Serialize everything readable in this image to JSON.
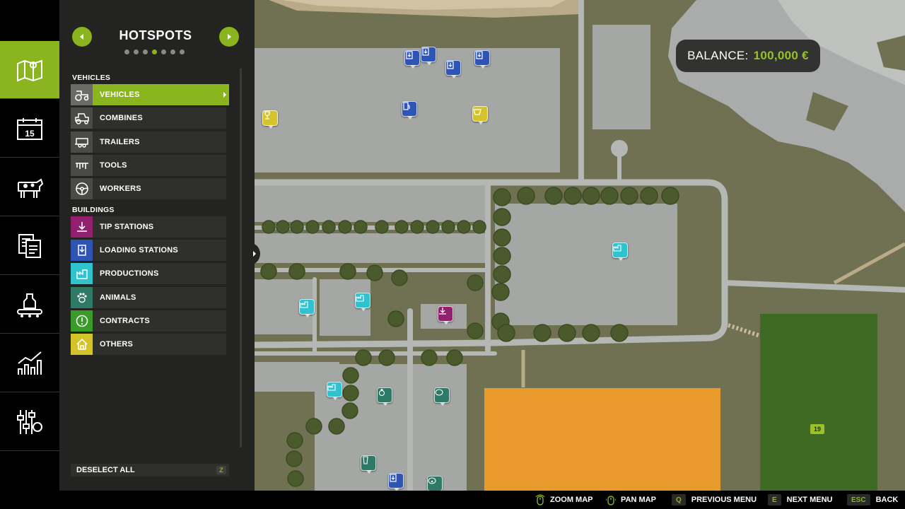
{
  "balance": {
    "label": "BALANCE:",
    "value": "100,000 €"
  },
  "nav": {
    "items": [
      {
        "name": "map",
        "icon": "map-icon",
        "active": true
      },
      {
        "name": "calendar",
        "icon": "calendar-icon",
        "calendar_day": "15"
      },
      {
        "name": "animals",
        "icon": "cow-icon"
      },
      {
        "name": "contracts",
        "icon": "contracts-icon"
      },
      {
        "name": "production",
        "icon": "production-icon"
      },
      {
        "name": "statistics",
        "icon": "statistics-icon"
      },
      {
        "name": "settings",
        "icon": "settings-icon"
      }
    ]
  },
  "panel": {
    "title": "HOTSPOTS",
    "page_dots": 7,
    "active_dot": 3,
    "sections": {
      "vehicles": "VEHICLES",
      "buildings": "BUILDINGS"
    },
    "vehicle_rows": [
      {
        "label": "VEHICLES",
        "icon": "tractor-icon",
        "active": true
      },
      {
        "label": "COMBINES",
        "icon": "combine-icon"
      },
      {
        "label": "TRAILERS",
        "icon": "trailer-icon"
      },
      {
        "label": "TOOLS",
        "icon": "tool-icon"
      },
      {
        "label": "WORKERS",
        "icon": "steering-wheel-icon"
      }
    ],
    "building_rows": [
      {
        "label": "TIP STATIONS",
        "icon": "tip-station-icon",
        "color": "#93206f"
      },
      {
        "label": "LOADING STATIONS",
        "icon": "loading-station-icon",
        "color": "#2f55b4"
      },
      {
        "label": "PRODUCTIONS",
        "icon": "factory-icon",
        "color": "#2ec3cf"
      },
      {
        "label": "ANIMALS",
        "icon": "paw-icon",
        "color": "#2f7a67"
      },
      {
        "label": "CONTRACTS",
        "icon": "exclamation-icon",
        "color": "#3a9a2a"
      },
      {
        "label": "OTHERS",
        "icon": "house-icon",
        "color": "#d4c42a"
      }
    ],
    "deselect": {
      "label": "DESELECT ALL",
      "key": "Z"
    }
  },
  "map": {
    "field_number": "19",
    "colors": {
      "grass": "#6f7152",
      "concrete": "#a5a7a5",
      "field_orange": "#e89b2c",
      "field_green": "#3f6a24",
      "water": "#a9acab",
      "tree": "#4a5a2c"
    }
  },
  "bottom_bar": {
    "hints": [
      {
        "icon": "mouse-icon",
        "label": "ZOOM MAP"
      },
      {
        "icon": "mouse-icon",
        "label": "PAN MAP"
      },
      {
        "key": "Q",
        "label": "PREVIOUS MENU"
      },
      {
        "key": "E",
        "label": "NEXT MENU"
      },
      {
        "key": "ESC",
        "label": "BACK"
      }
    ]
  },
  "accent_color": "#8ab51f"
}
